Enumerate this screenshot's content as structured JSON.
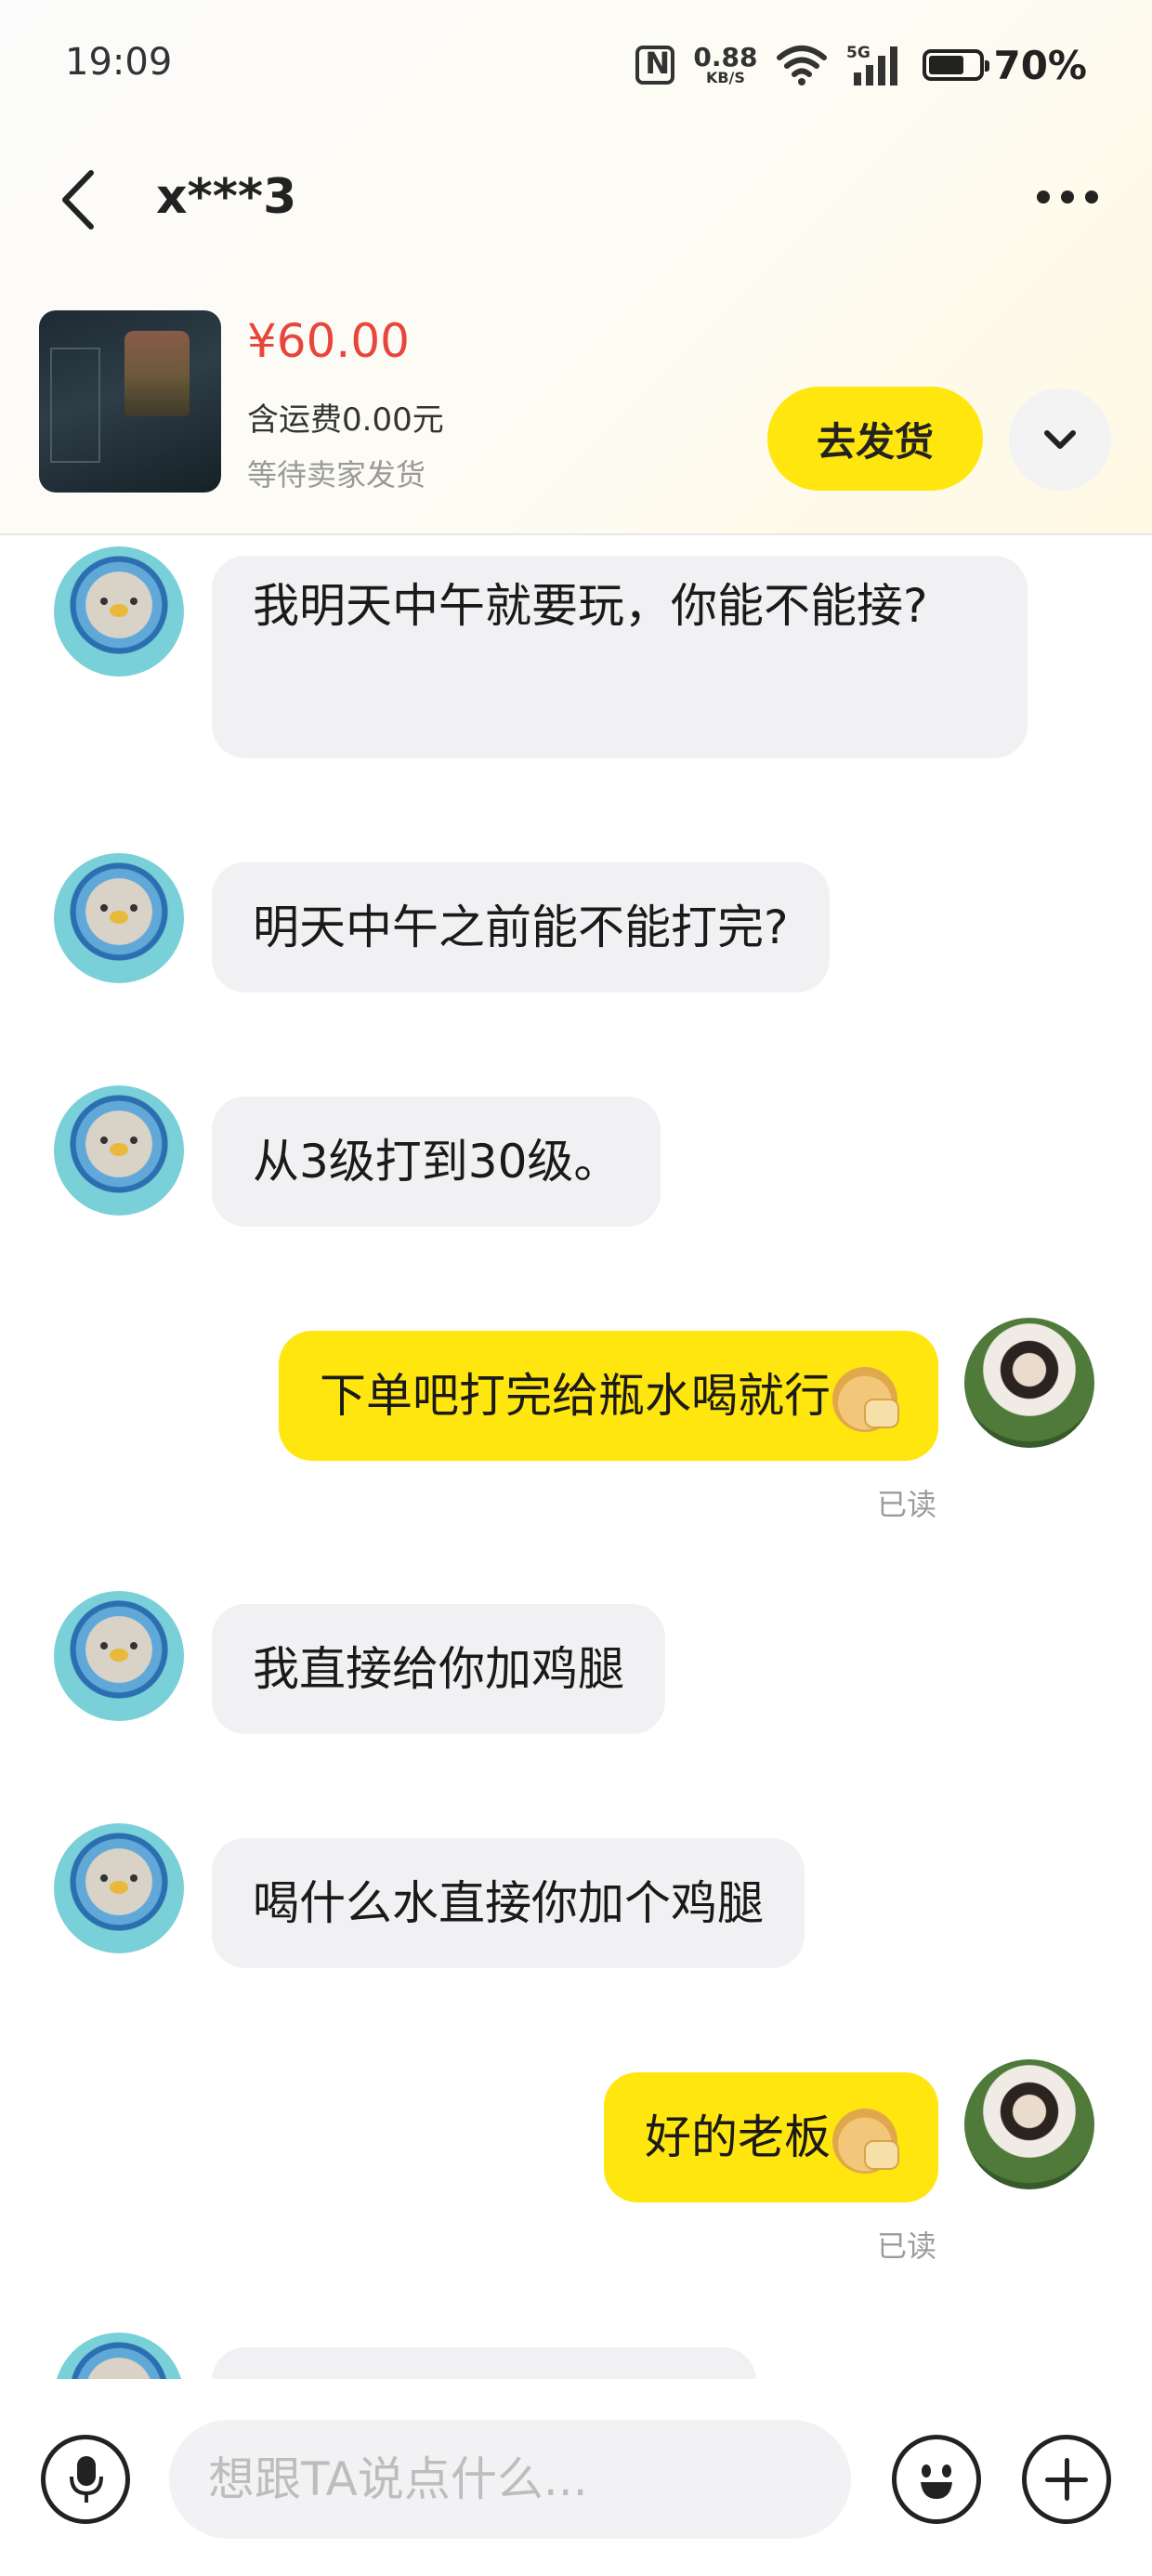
{
  "status_bar": {
    "time": "19:09",
    "net_speed_value": "0.88",
    "net_speed_unit": "KB/S",
    "network_type": "5G",
    "battery_percent": "70%",
    "battery_level": 0.7
  },
  "header": {
    "title": "x***3",
    "back_icon": "chevron-left-icon",
    "more_icon": "more-horizontal-icon"
  },
  "order": {
    "price": "¥60.00",
    "shipping": "含运费0.00元",
    "status": "等待卖家发货",
    "ship_button_label": "去发货",
    "expand_icon": "chevron-down-icon"
  },
  "messages": [
    {
      "side": "in",
      "text": "我明天中午就要玩，你能不能接?"
    },
    {
      "side": "in",
      "text": "明天中午之前能不能打完?"
    },
    {
      "side": "in",
      "text": "从3级打到30级。"
    },
    {
      "side": "out",
      "text": "下单吧打完给瓶水喝就行",
      "emoji": "doge-thumbs-up-emoji",
      "read": "已读"
    },
    {
      "side": "in",
      "text": "我直接给你加鸡腿"
    },
    {
      "side": "in",
      "text": "喝什么水直接你加个鸡腿"
    },
    {
      "side": "out",
      "text": "好的老板",
      "emoji": "doge-thumbs-up-emoji",
      "read": "已读"
    }
  ],
  "input_bar": {
    "placeholder": "想跟TA说点什么...",
    "voice_icon": "microphone-icon",
    "emoji_icon": "smiley-icon",
    "add_icon": "plus-icon"
  },
  "colors": {
    "accent_yellow": "#ffe60f",
    "price_red": "#e8453c",
    "incoming_bubble": "#f1f1f3"
  }
}
